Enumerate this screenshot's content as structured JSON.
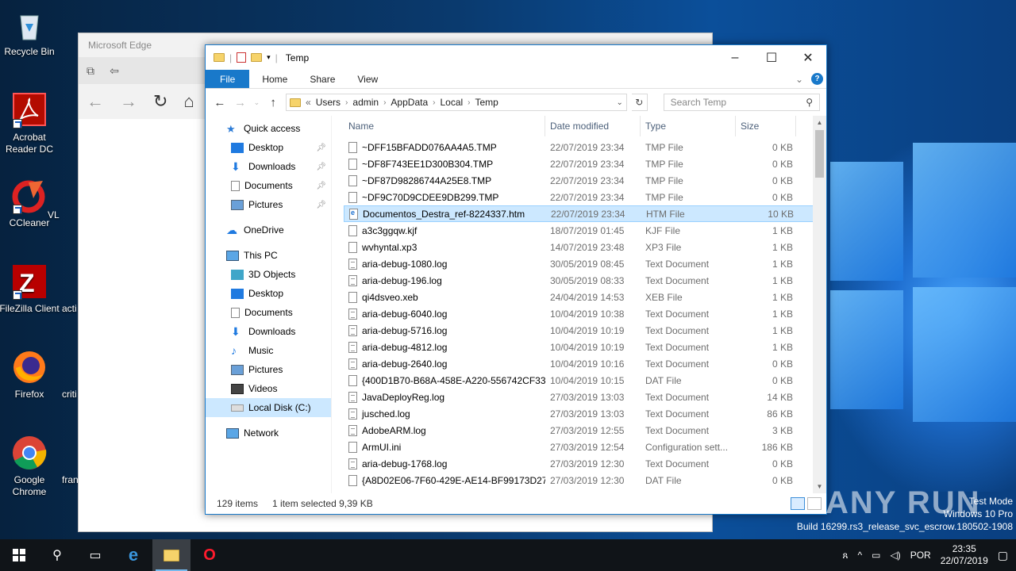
{
  "desktop": {
    "icons": [
      {
        "label": "Recycle Bin"
      },
      {
        "label": "Acrobat Reader DC"
      },
      {
        "label": "CCleaner"
      },
      {
        "label": "FileZilla Client"
      },
      {
        "label": "Firefox"
      },
      {
        "label": "Google Chrome"
      },
      {
        "label": "VL"
      },
      {
        "label": "acti"
      },
      {
        "label": "criti"
      },
      {
        "label": "fran"
      }
    ]
  },
  "edge": {
    "title": "Microsoft Edge"
  },
  "explorer": {
    "title": "Temp",
    "ribbon": {
      "file": "File",
      "home": "Home",
      "share": "Share",
      "view": "View"
    },
    "address": {
      "overflow": "«",
      "crumbs": [
        "Users",
        "admin",
        "AppData",
        "Local",
        "Temp"
      ]
    },
    "search_placeholder": "Search Temp",
    "nav": {
      "quick_access": "Quick access",
      "qa_items": [
        "Desktop",
        "Downloads",
        "Documents",
        "Pictures"
      ],
      "onedrive": "OneDrive",
      "this_pc": "This PC",
      "pc_items": [
        "3D Objects",
        "Desktop",
        "Documents",
        "Downloads",
        "Music",
        "Pictures",
        "Videos",
        "Local Disk (C:)"
      ],
      "network": "Network"
    },
    "columns": {
      "name": "Name",
      "date": "Date modified",
      "type": "Type",
      "size": "Size"
    },
    "files": [
      {
        "name": "~DFF15BFADD076AA4A5.TMP",
        "date": "22/07/2019 23:34",
        "type": "TMP File",
        "size": "0 KB"
      },
      {
        "name": "~DF8F743EE1D300B304.TMP",
        "date": "22/07/2019 23:34",
        "type": "TMP File",
        "size": "0 KB"
      },
      {
        "name": "~DF87D98286744A25E8.TMP",
        "date": "22/07/2019 23:34",
        "type": "TMP File",
        "size": "0 KB"
      },
      {
        "name": "~DF9C70D9CDEE9DB299.TMP",
        "date": "22/07/2019 23:34",
        "type": "TMP File",
        "size": "0 KB"
      },
      {
        "name": "Documentos_Destra_ref-8224337.htm",
        "date": "22/07/2019 23:34",
        "type": "HTM File",
        "size": "10 KB"
      },
      {
        "name": "a3c3ggqw.kjf",
        "date": "18/07/2019 01:45",
        "type": "KJF File",
        "size": "1 KB"
      },
      {
        "name": "wvhyntal.xp3",
        "date": "14/07/2019 23:48",
        "type": "XP3 File",
        "size": "1 KB"
      },
      {
        "name": "aria-debug-1080.log",
        "date": "30/05/2019 08:45",
        "type": "Text Document",
        "size": "1 KB"
      },
      {
        "name": "aria-debug-196.log",
        "date": "30/05/2019 08:33",
        "type": "Text Document",
        "size": "1 KB"
      },
      {
        "name": "qi4dsveo.xeb",
        "date": "24/04/2019 14:53",
        "type": "XEB File",
        "size": "1 KB"
      },
      {
        "name": "aria-debug-6040.log",
        "date": "10/04/2019 10:38",
        "type": "Text Document",
        "size": "1 KB"
      },
      {
        "name": "aria-debug-5716.log",
        "date": "10/04/2019 10:19",
        "type": "Text Document",
        "size": "1 KB"
      },
      {
        "name": "aria-debug-4812.log",
        "date": "10/04/2019 10:19",
        "type": "Text Document",
        "size": "1 KB"
      },
      {
        "name": "aria-debug-2640.log",
        "date": "10/04/2019 10:16",
        "type": "Text Document",
        "size": "0 KB"
      },
      {
        "name": "{400D1B70-B68A-458E-A220-556742CF33...",
        "date": "10/04/2019 10:15",
        "type": "DAT File",
        "size": "0 KB"
      },
      {
        "name": "JavaDeployReg.log",
        "date": "27/03/2019 13:03",
        "type": "Text Document",
        "size": "14 KB"
      },
      {
        "name": "jusched.log",
        "date": "27/03/2019 13:03",
        "type": "Text Document",
        "size": "86 KB"
      },
      {
        "name": "AdobeARM.log",
        "date": "27/03/2019 12:55",
        "type": "Text Document",
        "size": "3 KB"
      },
      {
        "name": "ArmUI.ini",
        "date": "27/03/2019 12:54",
        "type": "Configuration sett...",
        "size": "186 KB"
      },
      {
        "name": "aria-debug-1768.log",
        "date": "27/03/2019 12:30",
        "type": "Text Document",
        "size": "0 KB"
      },
      {
        "name": "{A8D02E06-7F60-429E-AE14-BF99173D27...",
        "date": "27/03/2019 12:30",
        "type": "DAT File",
        "size": "0 KB"
      }
    ],
    "status": {
      "count": "129 items",
      "selected": "1 item selected  9,39 KB"
    }
  },
  "watermark": {
    "line1": "Test Mode",
    "line2": "Windows 10 Pro",
    "line3": "Build 16299.rs3_release_svc_escrow.180502-1908",
    "brand": "ANY RUN"
  },
  "taskbar": {
    "lang": "POR",
    "time": "23:35",
    "date": "22/07/2019"
  }
}
